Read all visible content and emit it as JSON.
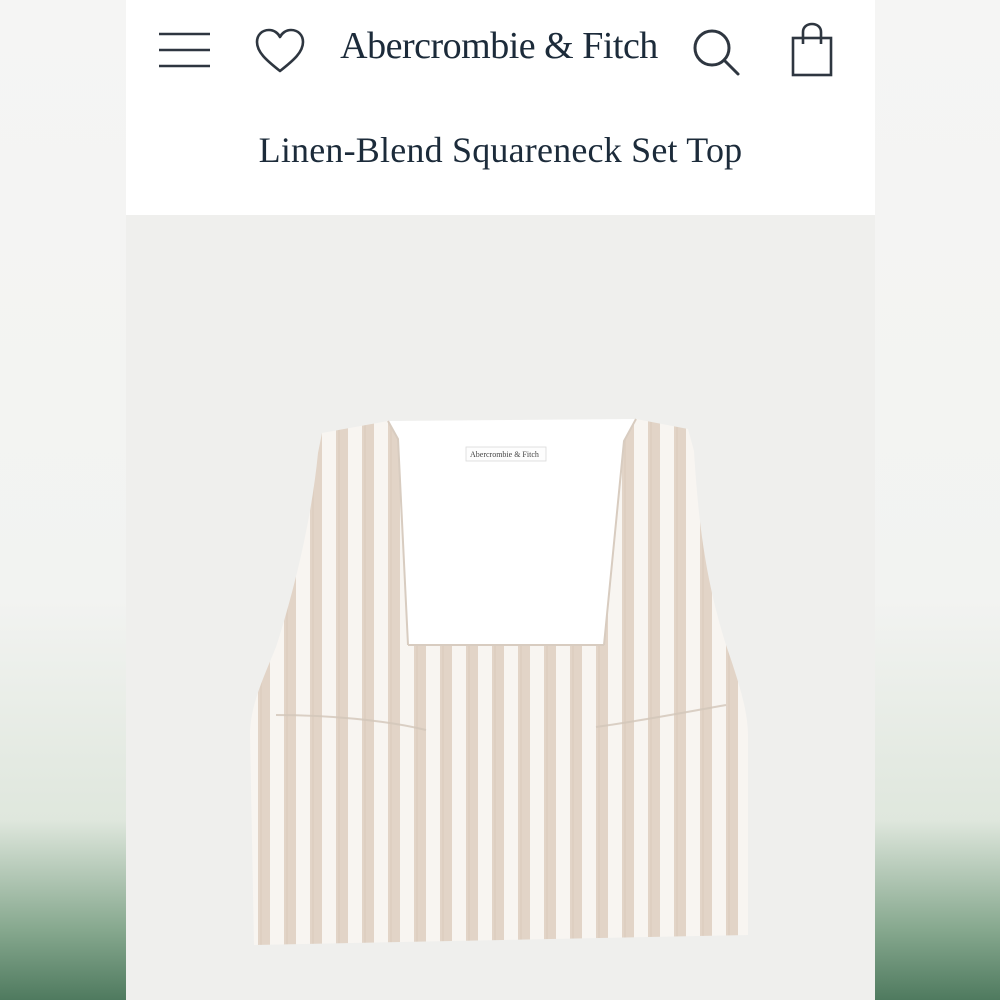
{
  "header": {
    "brand": "Abercrombie & Fitch",
    "menu_icon": "hamburger-menu-icon",
    "wishlist_icon": "heart-icon",
    "search_icon": "search-icon",
    "bag_icon": "shopping-bag-icon"
  },
  "product": {
    "title": "Linen-Blend Squareneck Set Top",
    "image_label": "Abercrombie & Fitch"
  },
  "colors": {
    "text_navy": "#1c2b3a",
    "stripe_beige": "#e4d6c9",
    "stripe_white": "#fbf9f6"
  }
}
